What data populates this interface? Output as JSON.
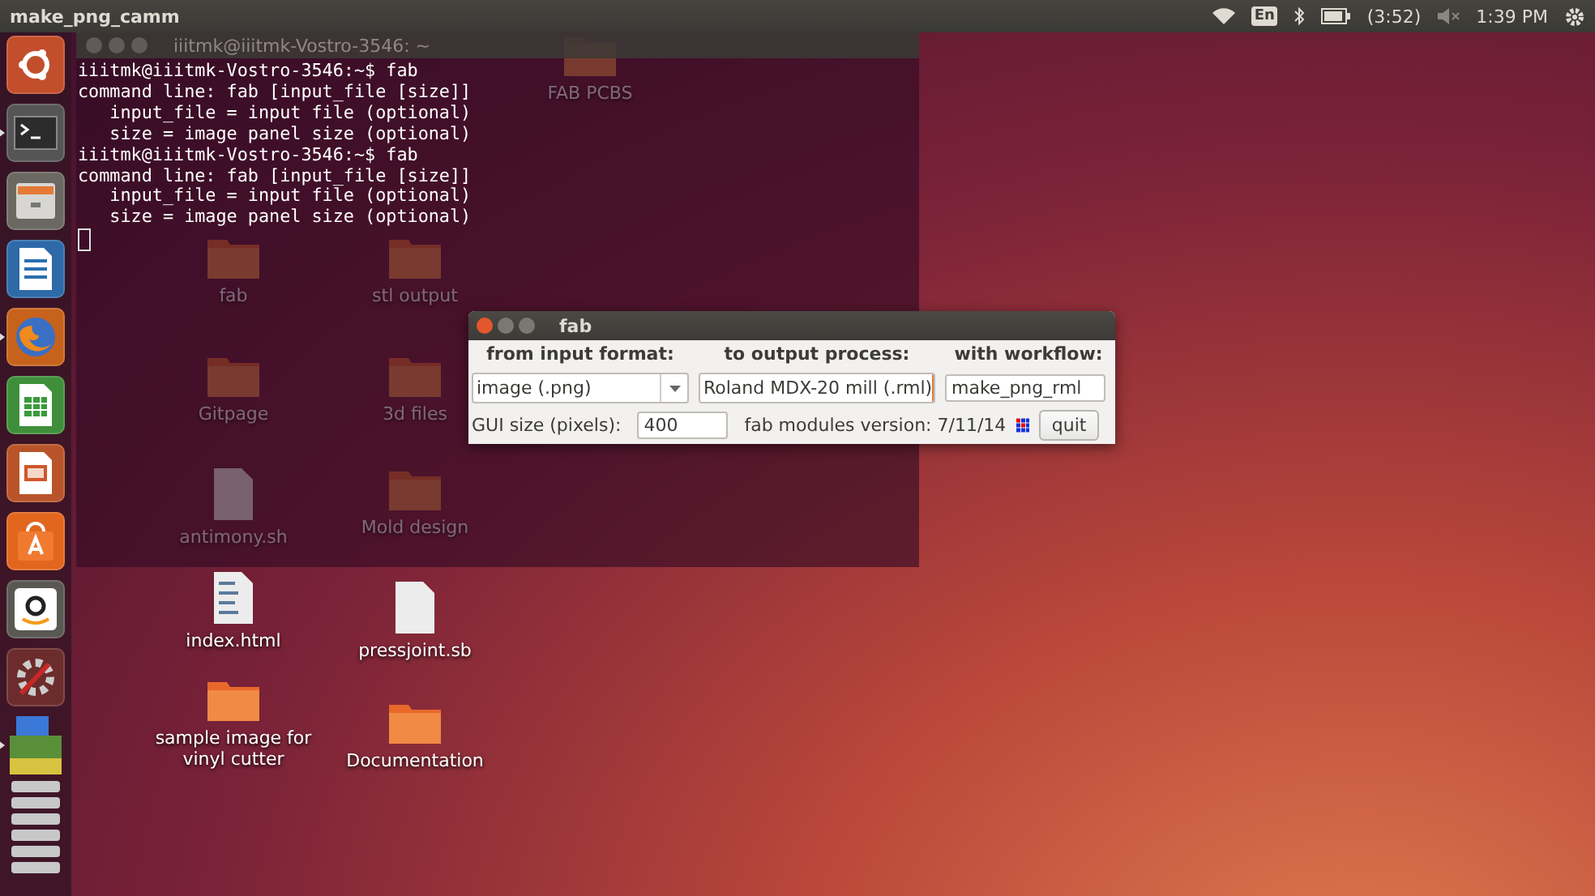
{
  "top_panel": {
    "title": "make_png_camm",
    "keyboard": "En",
    "battery": "(3:52)",
    "clock": "1:39 PM"
  },
  "launcher": [
    {
      "kind": "ubuntu",
      "running": false
    },
    {
      "kind": "terminal",
      "running": true
    },
    {
      "kind": "files",
      "running": false
    },
    {
      "kind": "writer",
      "running": false
    },
    {
      "kind": "firefox",
      "running": true
    },
    {
      "kind": "calc",
      "running": false
    },
    {
      "kind": "impress",
      "running": false
    },
    {
      "kind": "store",
      "running": false
    },
    {
      "kind": "amazon",
      "running": false
    },
    {
      "kind": "settings",
      "running": false
    },
    {
      "kind": "stack",
      "running": true
    }
  ],
  "desktop_icons": [
    {
      "kind": "folder",
      "label": "FAB PCBS"
    },
    {
      "kind": "folder",
      "label": "fab"
    },
    {
      "kind": "folder",
      "label": "stl output"
    },
    {
      "kind": "folder",
      "label": "Gitpage"
    },
    {
      "kind": "folder",
      "label": "3d files"
    },
    {
      "kind": "file",
      "label": "antimony.sh"
    },
    {
      "kind": "folder",
      "label": "Mold design"
    },
    {
      "kind": "html",
      "label": "index.html"
    },
    {
      "kind": "file",
      "label": "pressjoint.sb"
    },
    {
      "kind": "folder",
      "label": "sample image for vinyl cutter"
    },
    {
      "kind": "folder",
      "label": "Documentation"
    }
  ],
  "terminal": {
    "title": "iiitmk@iiitmk-Vostro-3546: ~",
    "lines": [
      "iiitmk@iiitmk-Vostro-3546:~$ fab",
      "command line: fab [input_file [size]]",
      "   input_file = input file (optional)",
      "   size = image panel size (optional)",
      "iiitmk@iiitmk-Vostro-3546:~$ fab",
      "command line: fab [input_file [size]]",
      "   input_file = input file (optional)",
      "   size = image panel size (optional)"
    ]
  },
  "fab_dialog": {
    "title": "fab",
    "from_label": "from input format:",
    "to_label": "to output process:",
    "workflow_label": "with workflow:",
    "input_format": "image (.png)",
    "output_process": "Roland MDX-20 mill (.rml)",
    "output_focused": true,
    "workflow": "make_png_rml",
    "gui_size_label": "GUI size (pixels):",
    "gui_size": "400",
    "version": "fab modules version: 7/11/14",
    "quit": "quit"
  }
}
